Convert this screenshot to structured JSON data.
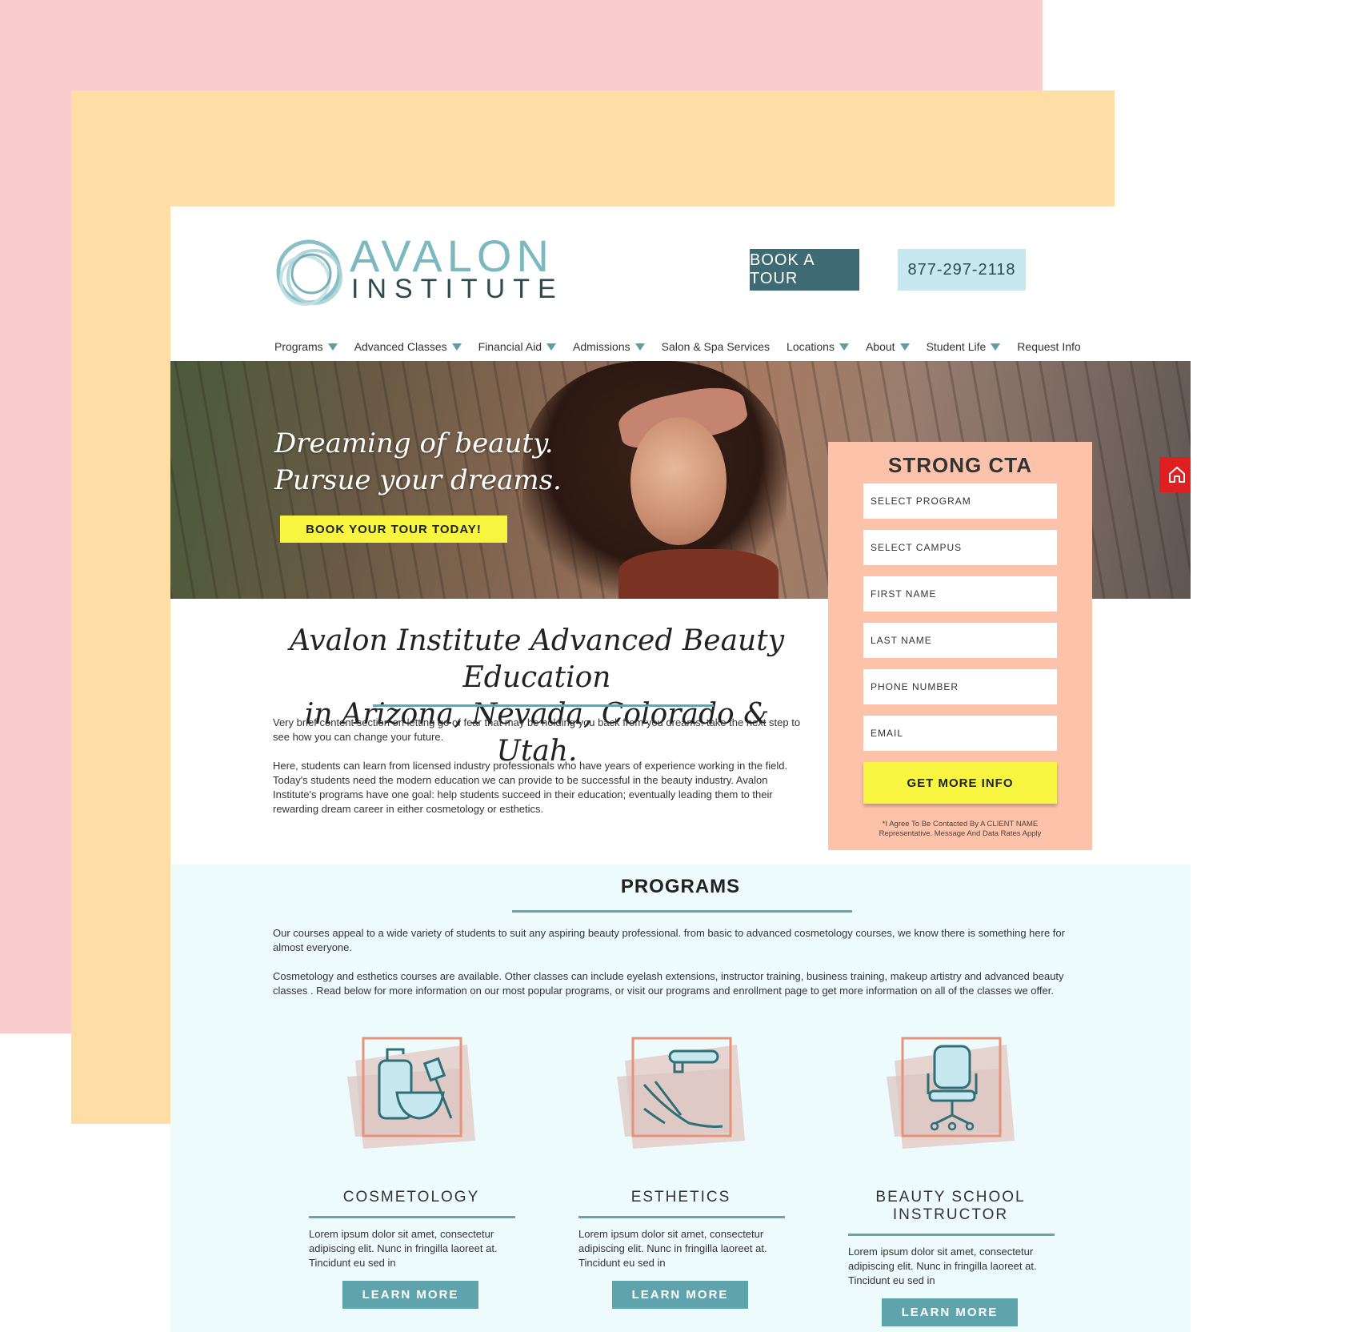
{
  "header": {
    "logo_line1": "AVALON",
    "logo_line2": "INSTITUTE",
    "book_tour_label": "BOOK A TOUR",
    "phone_label": "877-297-2118"
  },
  "nav": {
    "items": [
      {
        "label": "Programs",
        "dropdown": true
      },
      {
        "label": "Advanced Classes",
        "dropdown": true
      },
      {
        "label": "Financial Aid",
        "dropdown": true
      },
      {
        "label": "Admissions",
        "dropdown": true
      },
      {
        "label": "Salon & Spa Services",
        "dropdown": false
      },
      {
        "label": "Locations",
        "dropdown": true
      },
      {
        "label": "About",
        "dropdown": true
      },
      {
        "label": "Student Life",
        "dropdown": true
      },
      {
        "label": "Request Info",
        "dropdown": false
      }
    ]
  },
  "hero": {
    "title_line1": "Dreaming of beauty.",
    "title_line2": "Pursue your dreams.",
    "cta_label": "BOOK YOUR TOUR TODAY!"
  },
  "form": {
    "title": "STRONG CTA",
    "fields": [
      "SELECT PROGRAM",
      "SELECT CAMPUS",
      "FIRST NAME",
      "LAST NAME",
      "PHONE NUMBER",
      "EMAIL"
    ],
    "submit_label": "GET MORE INFO",
    "disclaimer_line1": "*I Agree To Be Contacted By A CLIENT NAME",
    "disclaimer_line2": "Representative. Message And Data Rates Apply"
  },
  "intro": {
    "title_line1": "Avalon Institute Advanced Beauty Education",
    "title_line2": "in Arizona, Nevada, Colorado & Utah.",
    "paragraph1": "Very brief content section on letting go of fear that may be holding you back from you dreams. take the next step to see how you can change your future.",
    "paragraph2": "Here, students can learn from licensed industry professionals who have years of experience working in the field. Today's students need the modern education we can provide to be successful in the beauty industry. Avalon Institute's programs have one goal: help students succeed in their education; eventually leading them to their rewarding dream career in either cosmetology or esthetics."
  },
  "programs": {
    "title": "PROGRAMS",
    "paragraph1": "Our courses appeal to a wide variety of students to suit any aspiring beauty professional. from basic to advanced cosmetology courses, we know there is something here for almost everyone.",
    "paragraph2": "Cosmetology and esthetics courses are available. Other classes can include eyelash extensions, instructor training, business training, makeup artistry and advanced beauty classes . Read below for more information on our most popular programs, or visit our programs and enrollment page to get more information on all of the classes we offer.",
    "cards": [
      {
        "title_line1": "COSMETOLOGY",
        "title_line2": "",
        "icon": "cosmetology-icon",
        "description": "Lorem ipsum dolor sit amet, consectetur adipiscing elit. Nunc in fringilla laoreet at. Tincidunt eu sed in",
        "button_label": "LEARN MORE"
      },
      {
        "title_line1": "ESTHETICS",
        "title_line2": "",
        "icon": "esthetics-icon",
        "description": "Lorem ipsum dolor sit amet, consectetur adipiscing elit. Nunc in fringilla laoreet at. Tincidunt eu sed in",
        "button_label": "LEARN MORE"
      },
      {
        "title_line1": "BEAUTY SCHOOL",
        "title_line2": "INSTRUCTOR",
        "icon": "chair-icon",
        "description": "Lorem ipsum dolor sit amet, consectetur adipiscing elit. Nunc in fringilla laoreet at. Tincidunt eu sed in",
        "button_label": "LEARN MORE"
      }
    ]
  },
  "colors": {
    "background_pink": "#f9cccd",
    "background_yellow": "#ffdea5",
    "teal_dark": "#3e6b73",
    "teal_light": "#c7e8ee",
    "teal_accent": "#5fa4ad",
    "yellow_cta": "#f7f53f",
    "peach_form": "#fdc3aa",
    "programs_bg": "#edfbfc",
    "home_badge": "#e02020"
  }
}
